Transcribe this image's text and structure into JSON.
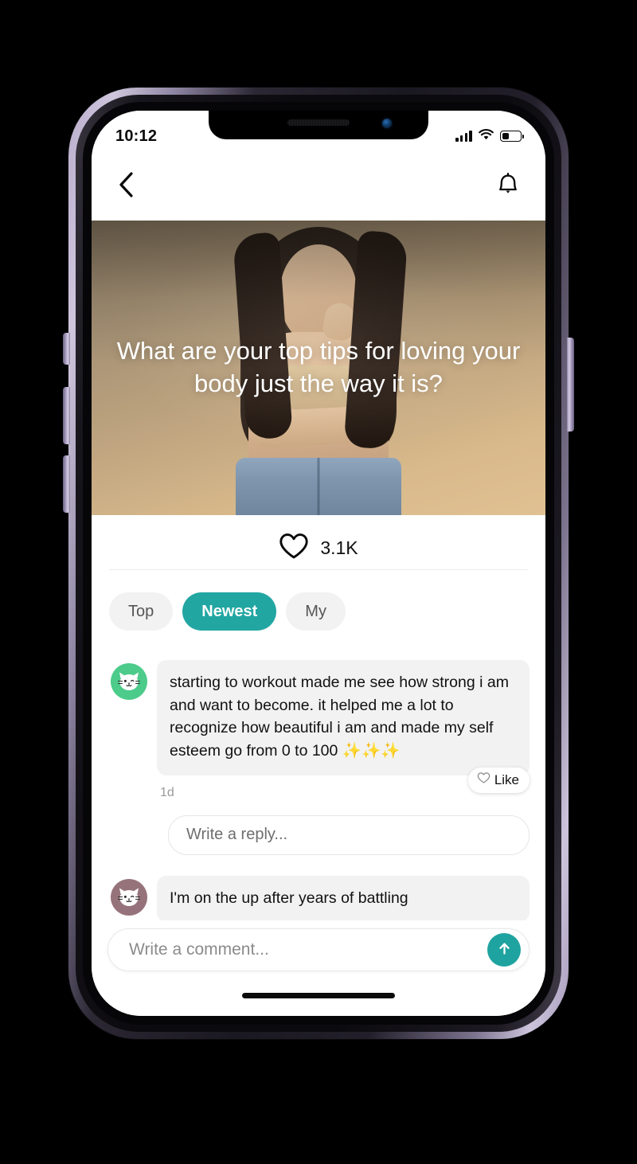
{
  "status_bar": {
    "time": "10:12",
    "signal_icon": "cellular-signal-icon",
    "wifi_icon": "wifi-icon",
    "battery_icon": "battery-icon"
  },
  "nav_bar": {
    "back_icon": "chevron-left-icon",
    "notifications_icon": "bell-icon"
  },
  "hero": {
    "title": "What are your top tips for loving your body just the way it is?",
    "image_alt": "smiling-woman-photo"
  },
  "engagement": {
    "like_icon": "heart-outline-icon",
    "like_count": "3.1K"
  },
  "filters": {
    "chips": [
      {
        "label": "Top",
        "active": false
      },
      {
        "label": "Newest",
        "active": true
      },
      {
        "label": "My",
        "active": false
      }
    ]
  },
  "comments": [
    {
      "avatar": "cat-avatar-green",
      "text": "starting to workout made me see how strong i am and want to become. it helped me a lot to recognize how beautiful i am and made my self esteem go from 0 to 100 ✨✨✨",
      "timestamp": "1d",
      "like_label": "Like",
      "like_icon": "heart-outline-icon",
      "reply_placeholder": "Write a reply..."
    },
    {
      "avatar": "cat-avatar-mauve",
      "text": "I'm on the up after years of battling"
    }
  ],
  "composer": {
    "placeholder": "Write a comment...",
    "value": "",
    "send_icon": "arrow-up-icon"
  },
  "colors": {
    "accent_teal": "#22a6a2",
    "send_teal": "#1fa3a0",
    "chip_inactive_bg": "#f2f2f2",
    "bubble_bg": "#f2f2f2",
    "avatar_green": "#4ccb8a",
    "avatar_mauve": "#96737a"
  }
}
